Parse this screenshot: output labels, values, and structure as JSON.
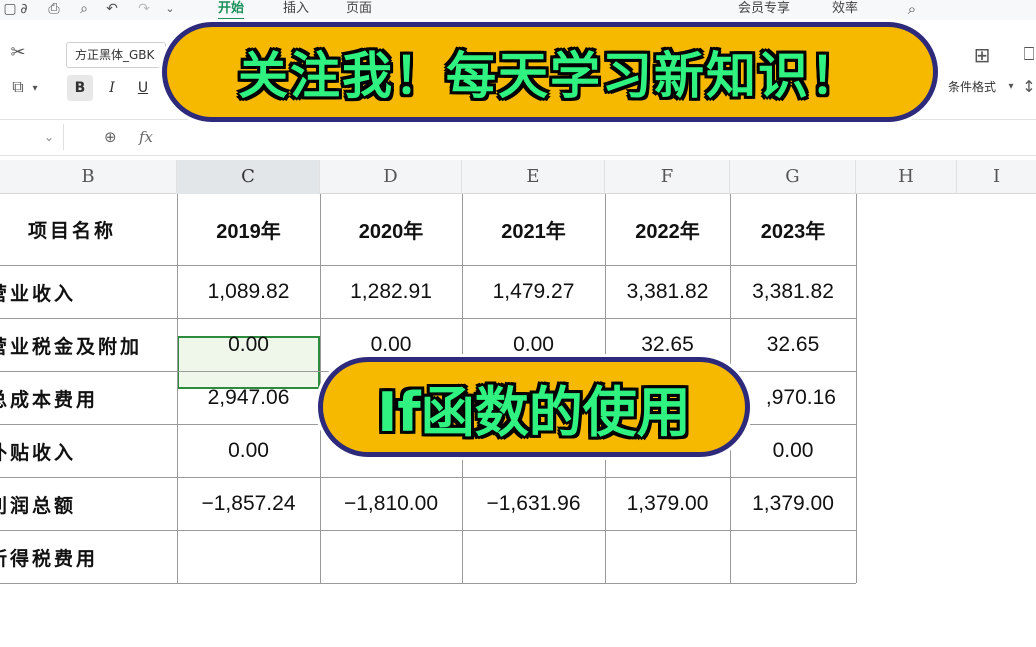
{
  "menu": {
    "tabs": [
      "开始",
      "插入",
      "页面"
    ],
    "right_items": [
      "会员专享",
      "效率"
    ]
  },
  "ribbon": {
    "font_name": "方正黑体_GBK",
    "bold": "B",
    "italic": "I",
    "underline": "U",
    "cond_format": "条件格式",
    "formula_fx": "fx"
  },
  "columns": [
    "B",
    "C",
    "D",
    "E",
    "F",
    "G",
    "H",
    "I"
  ],
  "table": {
    "header": [
      "项目名称",
      "2019年",
      "2020年",
      "2021年",
      "2022年",
      "2023年"
    ],
    "rows": [
      {
        "label": "营业收入",
        "values": [
          "1,089.82",
          "1,282.91",
          "1,479.27",
          "3,381.82",
          "3,381.82"
        ]
      },
      {
        "label": "营业税金及附加",
        "values": [
          "0.00",
          "0.00",
          "0.00",
          "32.65",
          "32.65"
        ]
      },
      {
        "label": "总成本费用",
        "values": [
          "2,947.06",
          "",
          "",
          "",
          ",970.16"
        ]
      },
      {
        "label": "补贴收入",
        "values": [
          "0.00",
          "",
          "",
          "",
          "0.00"
        ]
      },
      {
        "label": "利润总额",
        "values": [
          "−1,857.24",
          "−1,810.00",
          "−1,631.96",
          "1,379.00",
          "1,379.00"
        ]
      },
      {
        "label": "所得税费用",
        "values": [
          "",
          "",
          "",
          "",
          ""
        ]
      }
    ]
  },
  "banners": {
    "top": "关注我！每天学习新知识！",
    "middle": "If函数的使用"
  },
  "colors": {
    "accent_green": "#1a8f5a",
    "banner_fill": "#f7b800",
    "banner_border": "#2d2a7c",
    "banner_text": "#2ff280"
  }
}
